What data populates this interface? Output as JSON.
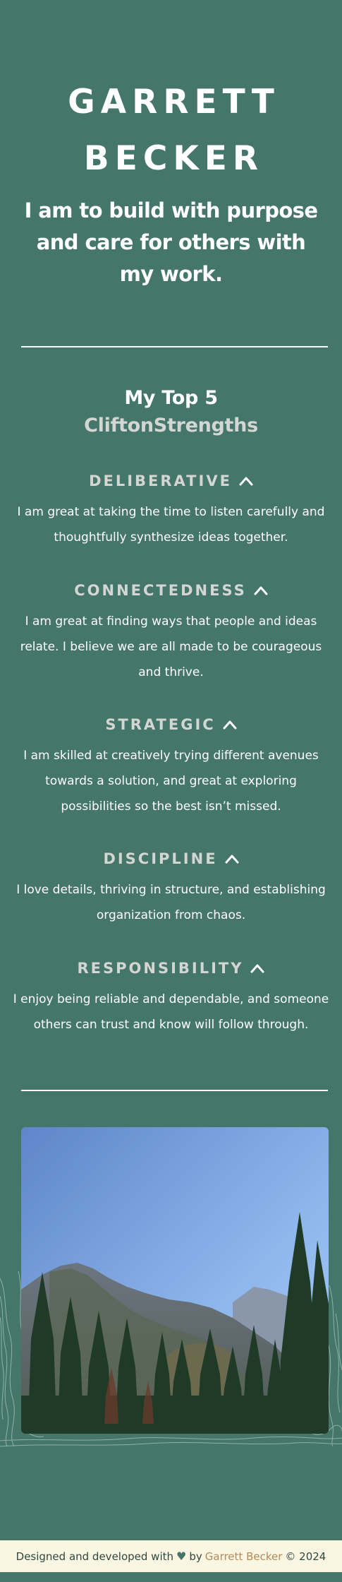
{
  "header": {
    "name_line1": "GARRETT",
    "name_line2": "BECKER",
    "tagline": "I am to build with purpose and care for others with my work."
  },
  "strengths_section": {
    "title_line1": "My Top 5",
    "title_line2": "CliftonStrengths",
    "items": [
      {
        "name": "DELIBERATIVE",
        "description": "I am great at taking the time to listen carefully and thoughtfully synthesize ideas together."
      },
      {
        "name": "CONNECTEDNESS",
        "description": "I am great at finding ways that people and ideas relate. I believe we are all made to be courageous and thrive."
      },
      {
        "name": "STRATEGIC",
        "description": "I am skilled at creatively trying different avenues towards a solution, and great at exploring possibilities so the best isn’t missed."
      },
      {
        "name": "DISCIPLINE",
        "description": "I love details, thriving in structure, and establishing organization from chaos."
      },
      {
        "name": "RESPONSIBILITY",
        "description": "I enjoy being reliable and dependable, and someone others can trust and know will follow through."
      }
    ]
  },
  "footer": {
    "prefix": "Designed and developed with",
    "heart_icon": "heart-icon",
    "by": "by",
    "author": "Garrett Becker",
    "copyright": "© 2024"
  },
  "colors": {
    "background": "#45766a",
    "accent_text": "#d3d6d2",
    "footer_bg": "#fbf6e2",
    "author_link": "#b58a5a"
  }
}
